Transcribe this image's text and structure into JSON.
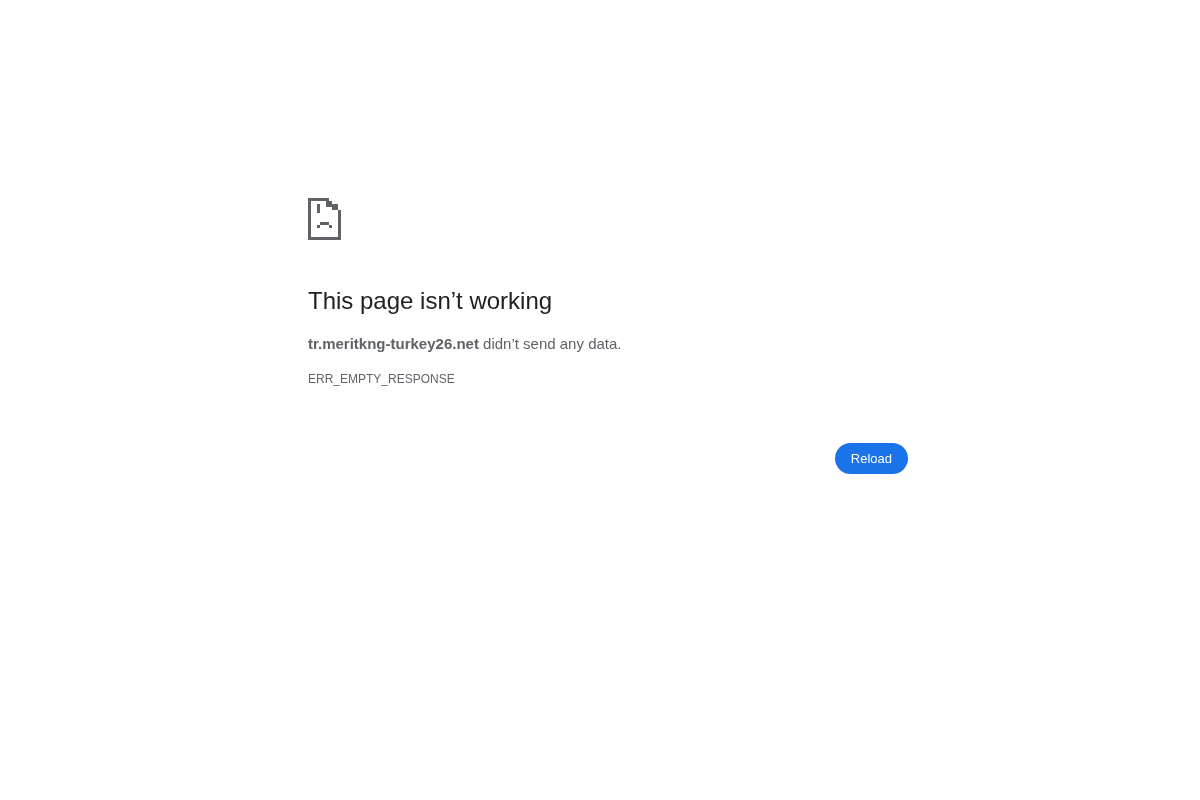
{
  "error_page": {
    "title": "This page isn’t working",
    "message": "**tr.meritkng-turkey26.net** didn’t send any data.",
    "error_code": "ERR_EMPTY_RESPONSE",
    "buttons": [
      "Reload"
    ]
  }
}
